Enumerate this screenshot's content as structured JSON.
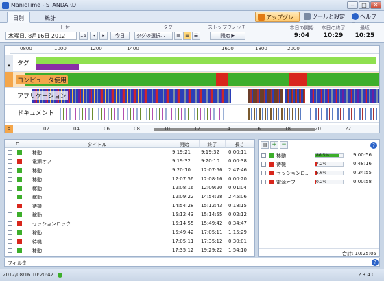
{
  "window": {
    "title": "ManicTime - STANDARD",
    "minimize": "‒",
    "maximize": "□",
    "close": "✕"
  },
  "ribbon": {
    "tabs": [
      "日別",
      "統計"
    ],
    "upgrade": "アップグレード",
    "tools": "ツールと設定",
    "help": "ヘルプ"
  },
  "controls": {
    "date_group": "日付",
    "date_value": "木曜日, 8月16日 2012",
    "calendar_day": "16",
    "prev": "◂",
    "next": "▸",
    "today": "今日",
    "tag_group": "タグ",
    "tag_select": "タグの選択...",
    "stopwatch_group": "ストップウォッチ",
    "start": "開始",
    "times": [
      {
        "label": "本日の開始",
        "value": "9:04"
      },
      {
        "label": "本日の終了",
        "value": "10:29"
      },
      {
        "label": "最近",
        "value": "10:25"
      }
    ]
  },
  "timeline": {
    "ruler": [
      "0800",
      "1000",
      "1200",
      "1400",
      "1600",
      "1800",
      "2000"
    ],
    "lanes": [
      "タグ",
      "コンピュータ使用",
      "アプリケーション",
      "ドキュメント"
    ],
    "lower_ticks": [
      "02",
      "04",
      "06",
      "08",
      "10",
      "12",
      "14",
      "16",
      "18",
      "20",
      "22"
    ]
  },
  "list": {
    "headers": [
      "D",
      "タイトル",
      "開始",
      "終了",
      "長さ"
    ],
    "rows": [
      {
        "title": "稼動",
        "start": "9:19:21",
        "end": "9:19:32",
        "dur": "0:00:11",
        "color": "green",
        "checked": false
      },
      {
        "title": "電源オフ",
        "start": "9:19:32",
        "end": "9:20:10",
        "dur": "0:00:38",
        "color": "red",
        "checked": true
      },
      {
        "title": "稼動",
        "start": "9:20:10",
        "end": "12:07:56",
        "dur": "2:47:46",
        "color": "green",
        "checked": true
      },
      {
        "title": "稼動",
        "start": "12:07:56",
        "end": "12:08:16",
        "dur": "0:00:20",
        "color": "green",
        "checked": false
      },
      {
        "title": "稼動",
        "start": "12:08:16",
        "end": "12:09:20",
        "dur": "0:01:04",
        "color": "green",
        "checked": false
      },
      {
        "title": "稼動",
        "start": "12:09:22",
        "end": "14:54:28",
        "dur": "2:45:06",
        "color": "green",
        "checked": false
      },
      {
        "title": "待機",
        "start": "14:54:28",
        "end": "15:12:43",
        "dur": "0:18:15",
        "color": "red",
        "checked": false
      },
      {
        "title": "稼動",
        "start": "15:12:43",
        "end": "15:14:55",
        "dur": "0:02:12",
        "color": "green",
        "checked": false
      },
      {
        "title": "セッションロック",
        "start": "15:14:55",
        "end": "15:49:42",
        "dur": "0:34:47",
        "color": "red",
        "checked": false
      },
      {
        "title": "稼動",
        "start": "15:49:42",
        "end": "17:05:11",
        "dur": "1:15:29",
        "color": "green",
        "checked": false
      },
      {
        "title": "待機",
        "start": "17:05:11",
        "end": "17:35:12",
        "dur": "0:30:01",
        "color": "red",
        "checked": false
      },
      {
        "title": "稼動",
        "start": "17:35:12",
        "end": "19:29:22",
        "dur": "1:54:10",
        "color": "green",
        "checked": false
      }
    ]
  },
  "summary": {
    "rows": [
      {
        "name": "稼動",
        "pct": "86.5%",
        "frac": 0.865,
        "dur": "9:00:56",
        "color": "green"
      },
      {
        "name": "待機",
        "pct": "7.2%",
        "frac": 0.072,
        "dur": "0:48:16",
        "color": "red"
      },
      {
        "name": "セッションロ...",
        "pct": "5.6%",
        "frac": 0.056,
        "dur": "0:34:55",
        "color": "red"
      },
      {
        "name": "電源オフ",
        "pct": "0.2%",
        "frac": 0.002,
        "dur": "0:00:58",
        "color": "red"
      }
    ],
    "total": "合計: 10:25:05"
  },
  "filter": {
    "label": "フィルタ"
  },
  "status": {
    "datetime": "2012/08/16 10:20:42",
    "version": "2.3.4.0"
  },
  "colors": {
    "green": "#3dae2b",
    "red": "#d8261c"
  }
}
